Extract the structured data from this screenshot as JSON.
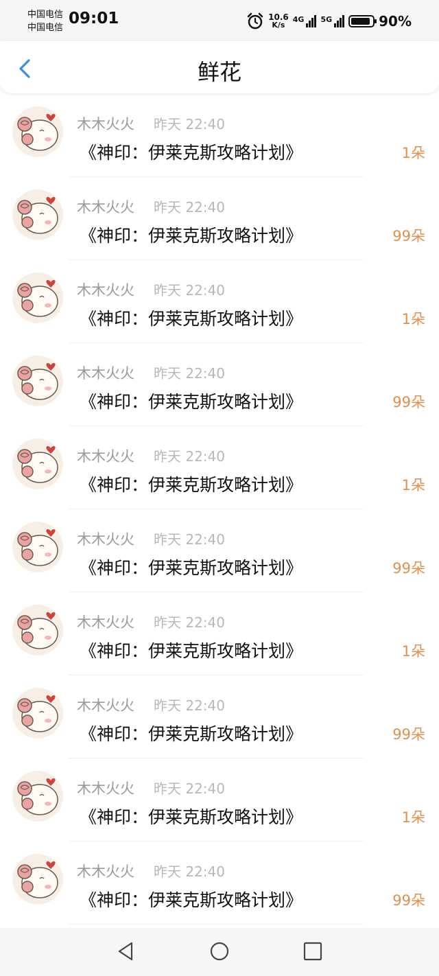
{
  "status_bar": {
    "carrier_1": "中国电信",
    "carrier_2": "中国电信",
    "time": "09:01",
    "net_speed_value": "10.6",
    "net_speed_unit": "K/s",
    "signal_1_label": "4G",
    "signal_2_label": "5G",
    "battery_level": 0.9,
    "battery_text": "90%",
    "icons": [
      "alarm-icon",
      "signal-icon",
      "battery-icon"
    ]
  },
  "header": {
    "title": "鲜花",
    "back_icon": "chevron-left-icon",
    "accent_color": "#3a8ee6"
  },
  "colors": {
    "name": "#9a9a9a",
    "time": "#b8b8b8",
    "count": "#e0904e"
  },
  "items": [
    {
      "name": "木木火火",
      "time": "昨天 22:40",
      "book": "《神印：伊莱克斯攻略计划》",
      "count": "1朵"
    },
    {
      "name": "木木火火",
      "time": "昨天 22:40",
      "book": "《神印：伊莱克斯攻略计划》",
      "count": "99朵"
    },
    {
      "name": "木木火火",
      "time": "昨天 22:40",
      "book": "《神印：伊莱克斯攻略计划》",
      "count": "1朵"
    },
    {
      "name": "木木火火",
      "time": "昨天 22:40",
      "book": "《神印：伊莱克斯攻略计划》",
      "count": "99朵"
    },
    {
      "name": "木木火火",
      "time": "昨天 22:40",
      "book": "《神印：伊莱克斯攻略计划》",
      "count": "1朵"
    },
    {
      "name": "木木火火",
      "time": "昨天 22:40",
      "book": "《神印：伊莱克斯攻略计划》",
      "count": "99朵"
    },
    {
      "name": "木木火火",
      "time": "昨天 22:40",
      "book": "《神印：伊莱克斯攻略计划》",
      "count": "1朵"
    },
    {
      "name": "木木火火",
      "time": "昨天 22:40",
      "book": "《神印：伊莱克斯攻略计划》",
      "count": "99朵"
    },
    {
      "name": "木木火火",
      "time": "昨天 22:40",
      "book": "《神印：伊莱克斯攻略计划》",
      "count": "1朵"
    },
    {
      "name": "木木火火",
      "time": "昨天 22:40",
      "book": "《神印：伊莱克斯攻略计划》",
      "count": "99朵"
    }
  ],
  "nav_bar": {
    "icons": [
      "nav-back-icon",
      "nav-home-icon",
      "nav-recents-icon"
    ]
  }
}
